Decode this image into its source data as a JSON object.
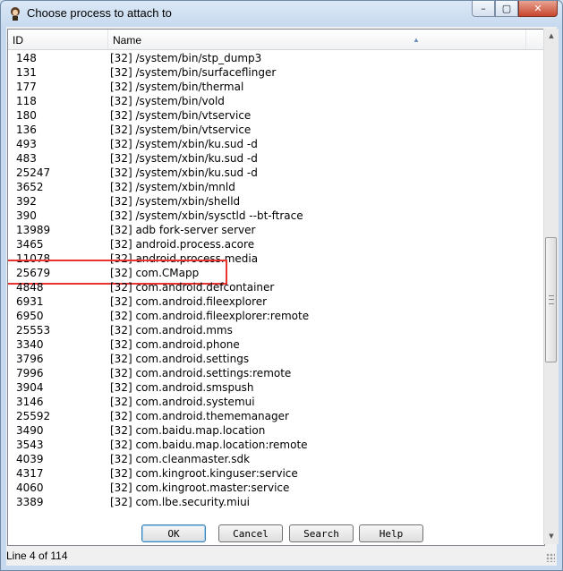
{
  "window": {
    "title": "Choose process to attach to"
  },
  "caption": {
    "minimize": "–",
    "maximize": "▢",
    "close": "✕"
  },
  "table": {
    "columns": {
      "id": "ID",
      "name": "Name"
    },
    "rows": [
      {
        "id": "148",
        "name": "[32] /system/bin/stp_dump3"
      },
      {
        "id": "131",
        "name": "[32] /system/bin/surfaceflinger"
      },
      {
        "id": "177",
        "name": "[32] /system/bin/thermal"
      },
      {
        "id": "118",
        "name": "[32] /system/bin/vold"
      },
      {
        "id": "180",
        "name": "[32] /system/bin/vtservice"
      },
      {
        "id": "136",
        "name": "[32] /system/bin/vtservice"
      },
      {
        "id": "493",
        "name": "[32] /system/xbin/ku.sud -d"
      },
      {
        "id": "483",
        "name": "[32] /system/xbin/ku.sud -d"
      },
      {
        "id": "25247",
        "name": "[32] /system/xbin/ku.sud -d"
      },
      {
        "id": "3652",
        "name": "[32] /system/xbin/mnld"
      },
      {
        "id": "392",
        "name": "[32] /system/xbin/shelld"
      },
      {
        "id": "390",
        "name": "[32] /system/xbin/sysctld --bt-ftrace"
      },
      {
        "id": "13989",
        "name": "[32] adb fork-server server"
      },
      {
        "id": "3465",
        "name": "[32] android.process.acore"
      },
      {
        "id": "11078",
        "name": "[32] android.process.media"
      },
      {
        "id": "25679",
        "name": "[32] com.CMapp"
      },
      {
        "id": "4848",
        "name": "[32] com.android.defcontainer"
      },
      {
        "id": "6931",
        "name": "[32] com.android.fileexplorer"
      },
      {
        "id": "6950",
        "name": "[32] com.android.fileexplorer:remote"
      },
      {
        "id": "25553",
        "name": "[32] com.android.mms"
      },
      {
        "id": "3340",
        "name": "[32] com.android.phone"
      },
      {
        "id": "3796",
        "name": "[32] com.android.settings"
      },
      {
        "id": "7996",
        "name": "[32] com.android.settings:remote"
      },
      {
        "id": "3904",
        "name": "[32] com.android.smspush"
      },
      {
        "id": "3146",
        "name": "[32] com.android.systemui"
      },
      {
        "id": "25592",
        "name": "[32] com.android.thememanager"
      },
      {
        "id": "3490",
        "name": "[32] com.baidu.map.location"
      },
      {
        "id": "3543",
        "name": "[32] com.baidu.map.location:remote"
      },
      {
        "id": "4039",
        "name": "[32] com.cleanmaster.sdk"
      },
      {
        "id": "4317",
        "name": "[32] com.kingroot.kinguser:service"
      },
      {
        "id": "4060",
        "name": "[32] com.kingroot.master:service"
      },
      {
        "id": "3389",
        "name": "[32] com.lbe.security.miui"
      }
    ]
  },
  "buttons": {
    "ok": "OK",
    "cancel": "Cancel",
    "search": "Search",
    "help": "Help"
  },
  "status": {
    "text": "Line 4 of 114"
  },
  "colors": {
    "highlight": "#e8332e",
    "close_button": "#c7462d"
  }
}
